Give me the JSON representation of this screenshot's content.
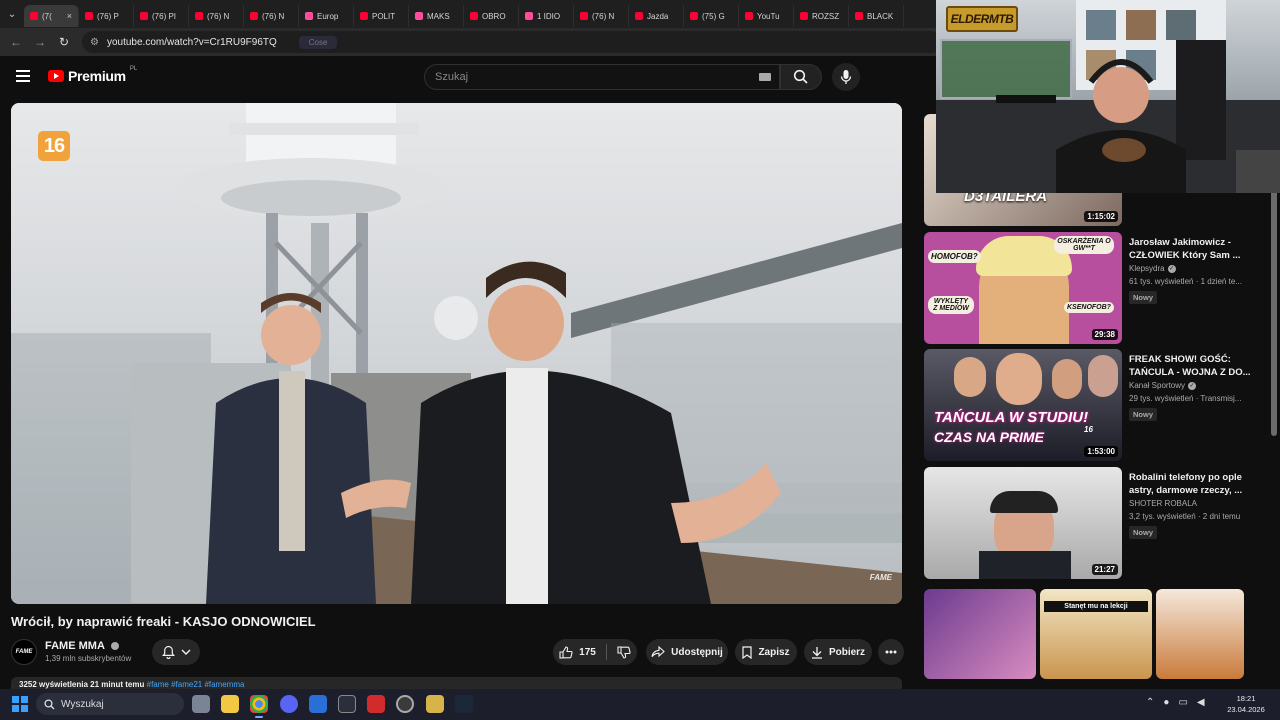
{
  "browser": {
    "tabs": [
      {
        "label": "(7(",
        "active": true
      },
      {
        "label": "(76) P"
      },
      {
        "label": "(76) PI"
      },
      {
        "label": "(76) N"
      },
      {
        "label": "(76) N"
      },
      {
        "label": "Europ"
      },
      {
        "label": "POLIT"
      },
      {
        "label": "MAKS"
      },
      {
        "label": "OBRO"
      },
      {
        "label": "1 IDIO"
      },
      {
        "label": "(76) N"
      },
      {
        "label": "Jazda"
      },
      {
        "label": "(75) G"
      },
      {
        "label": "YouTu"
      },
      {
        "label": "ROZSZ"
      },
      {
        "label": "BLACK"
      }
    ],
    "tab_close": "×",
    "url": "youtube.com/watch?v=Cr1RU9F96TQ",
    "url_chip": "Cose"
  },
  "youtube": {
    "logo_text": "Premium",
    "logo_region": "PL",
    "search_placeholder": "Szukaj"
  },
  "video": {
    "age_rating": "16",
    "watermark": "FAME",
    "title": "Wrócił, by naprawić freaki - KASJO ODNOWICIEL",
    "channel": {
      "name": "FAME MMA",
      "subscribers": "1,39 mln subskrybentów",
      "avatar_text": "FAME"
    },
    "actions": {
      "likes": "175",
      "share": "Udostępnij",
      "save": "Zapisz",
      "download": "Pobierz"
    },
    "description_line": "3252 wyświetlenia  21 minut temu",
    "description_tags": "#fame #fame21 #famemma"
  },
  "recommendations": [
    {
      "thumb_text": "NITRO MIAŻDŻY D3TAILERA",
      "duration": "1:15:02",
      "title": "",
      "channel": "",
      "meta": "",
      "badge": ""
    },
    {
      "thumb_text_1": "HOMOFOB?",
      "thumb_text_2": "OSKARŻENIA O GW**T",
      "thumb_text_3": "WYKLĘTY Z MEDIÓW",
      "thumb_text_4": "KSENOFOB?",
      "duration": "29:38",
      "title": "Jarosław Jakimowicz - CZŁOWIEK Który Sam ...",
      "channel": "Klepsydra",
      "meta": "61 tys. wyświetleń · 1 dzień te...",
      "badge": "Nowy"
    },
    {
      "thumb_text_1": "TAŃCULA W STUDIU!",
      "thumb_text_2": "CZAS NA PRIME",
      "thumb_text_3": "16",
      "duration": "1:53:00",
      "title": "FREAK SHOW! GOŚĆ: TAŃCULA - WOJNA Z DO...",
      "channel": "Kanał Sportowy",
      "meta": "29 tys. wyświetleń · Transmisj...",
      "badge": "Nowy"
    },
    {
      "duration": "21:27",
      "title": "Robalini telefony po ople astry, darmowe rzeczy, ...",
      "channel": "SHOTER ROBALA",
      "meta": "3,2 tys. wyświetleń · 2 dni temu",
      "badge": "Nowy"
    },
    {
      "thumb_text": "Stanęt mu na lekcji",
      "duration": "",
      "title": "",
      "channel": "",
      "meta": "",
      "badge": ""
    }
  ],
  "overlay": {
    "logo_text": "ELDERMTB"
  },
  "taskbar": {
    "search_placeholder": "Wyszukaj",
    "time": "18:21",
    "date": "23.04.2026"
  }
}
